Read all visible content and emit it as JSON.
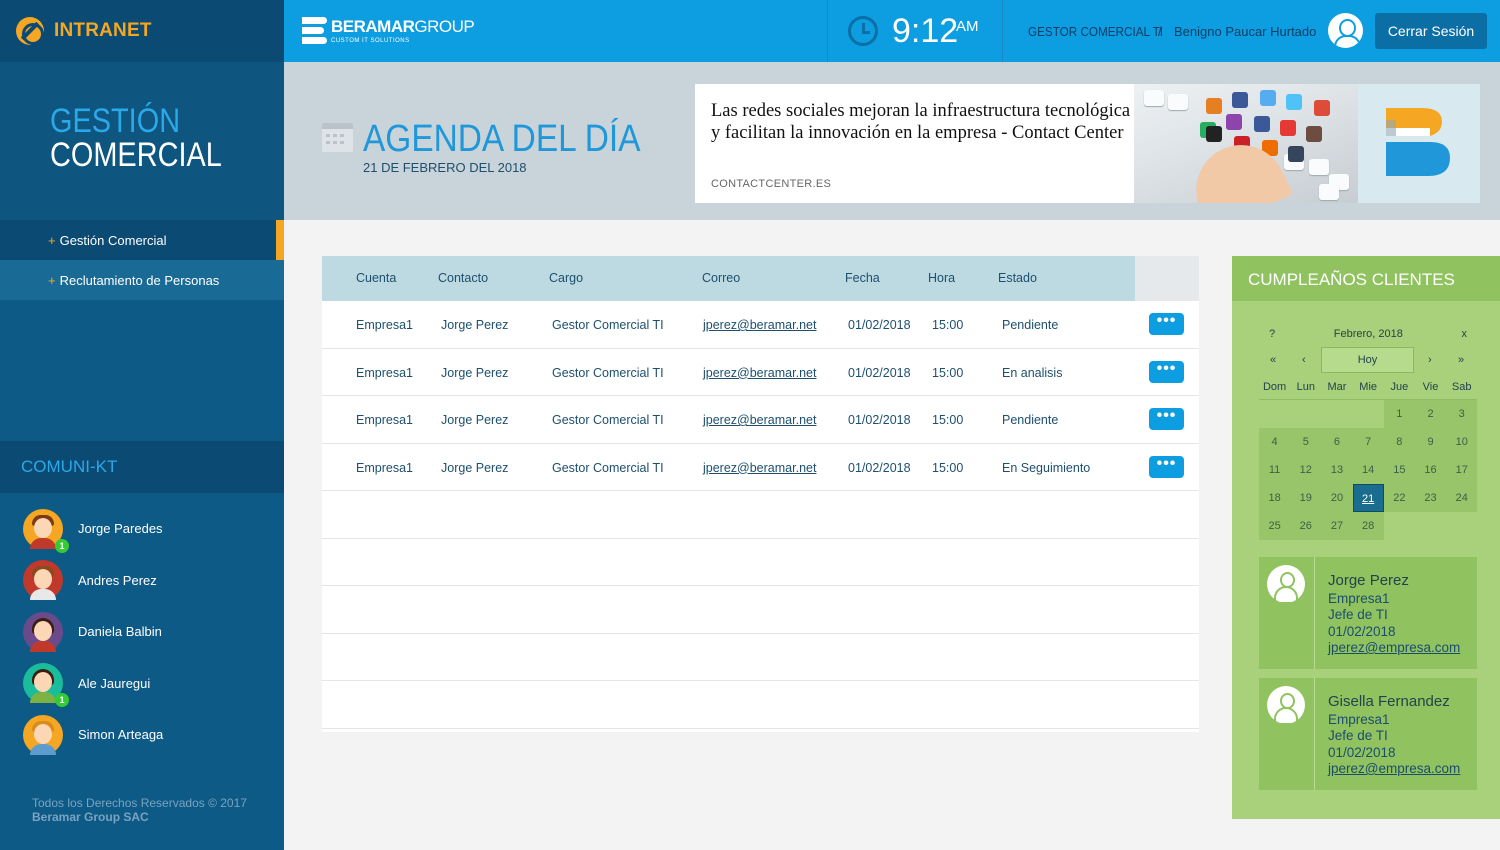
{
  "app": {
    "logo_text": "INTRANET"
  },
  "sidebar": {
    "title_line1": "GESTIÓN",
    "title_line2": "COMERCIAL",
    "items": [
      {
        "label": "Gestión Comercial",
        "active": true
      },
      {
        "label": "Reclutamiento de Personas",
        "active": false
      }
    ],
    "comuni_title": "COMUNI-KT",
    "contacts": [
      {
        "name": "Jorge Paredes",
        "badge": "1"
      },
      {
        "name": "Andres Perez",
        "badge": ""
      },
      {
        "name": "Daniela Balbin",
        "badge": ""
      },
      {
        "name": "Ale Jauregui",
        "badge": "1"
      },
      {
        "name": "Simon Arteaga",
        "badge": ""
      }
    ],
    "footer_line1": "Todos los Derechos Reservados © 2017",
    "footer_line2": "Beramar Group SAC"
  },
  "header": {
    "brand_bold": "BERAMAR",
    "brand_light": "GROUP",
    "brand_sub": "CUSTOM IT SOLUTIONS",
    "time": "9:12",
    "ampm": "AM",
    "role": "GESTOR COMERCIAL TI",
    "separator": "/",
    "user_name": "Benigno Paucar Hurtado",
    "logout_label": "Cerrar Sesión"
  },
  "banner": {
    "title": "AGENDA DEL DÍA",
    "date": "21 DE FEBRERO DEL 2018",
    "news_text": "Las redes sociales mejoran la infraestructura tecnológica y facilitan la innovación en la empresa - Contact Center",
    "news_source": "CONTACTCENTER.ES"
  },
  "table": {
    "headers": [
      "Cuenta",
      "Contacto",
      "Cargo",
      "Correo",
      "Fecha",
      "Hora",
      "Estado"
    ],
    "more_label": "•••",
    "rows": [
      [
        "Empresa1",
        "Jorge Perez",
        "Gestor Comercial TI",
        "jperez@beramar.net",
        "01/02/2018",
        "15:00",
        "Pendiente"
      ],
      [
        "Empresa1",
        "Jorge Perez",
        "Gestor Comercial TI",
        "jperez@beramar.net",
        "01/02/2018",
        "15:00",
        "En analisis"
      ],
      [
        "Empresa1",
        "Jorge Perez",
        "Gestor Comercial TI",
        "jperez@beramar.net",
        "01/02/2018",
        "15:00",
        "Pendiente"
      ],
      [
        "Empresa1",
        "Jorge Perez",
        "Gestor Comercial TI",
        "jperez@beramar.net",
        "01/02/2018",
        "15:00",
        "En Seguimiento"
      ]
    ]
  },
  "birthdays": {
    "title": "CUMPLEAÑOS CLIENTES",
    "calendar": {
      "help": "?",
      "month": "Febrero, 2018",
      "close": "x",
      "prev_year": "«",
      "prev_month": "‹",
      "today": "Hoy",
      "next_month": "›",
      "next_year": "»",
      "weekdays": [
        "Dom",
        "Lun",
        "Mar",
        "Mie",
        "Jue",
        "Vie",
        "Sab"
      ],
      "days": [
        "",
        "",
        "",
        "",
        "1",
        "2",
        "3",
        "4",
        "5",
        "6",
        "7",
        "8",
        "9",
        "10",
        "11",
        "12",
        "13",
        "14",
        "15",
        "16",
        "17",
        "18",
        "19",
        "20",
        "21",
        "22",
        "23",
        "24",
        "25",
        "26",
        "27",
        "28"
      ],
      "selected": "21"
    },
    "cards": [
      {
        "name": "Jorge Perez",
        "company": "Empresa1",
        "role": "Jefe de TI",
        "date": "01/02/2018",
        "email": "jperez@empresa.com",
        "gender": "male"
      },
      {
        "name": "Gisella Fernandez",
        "company": "Empresa1",
        "role": "Jefe de TI",
        "date": "01/02/2018",
        "email": "jperez@empresa.com",
        "gender": "female"
      }
    ]
  },
  "colors": {
    "primary": "#0d9de1",
    "sidebar": "#0d5a87",
    "accent": "#f5a623",
    "birthday": "#a9d07a"
  }
}
